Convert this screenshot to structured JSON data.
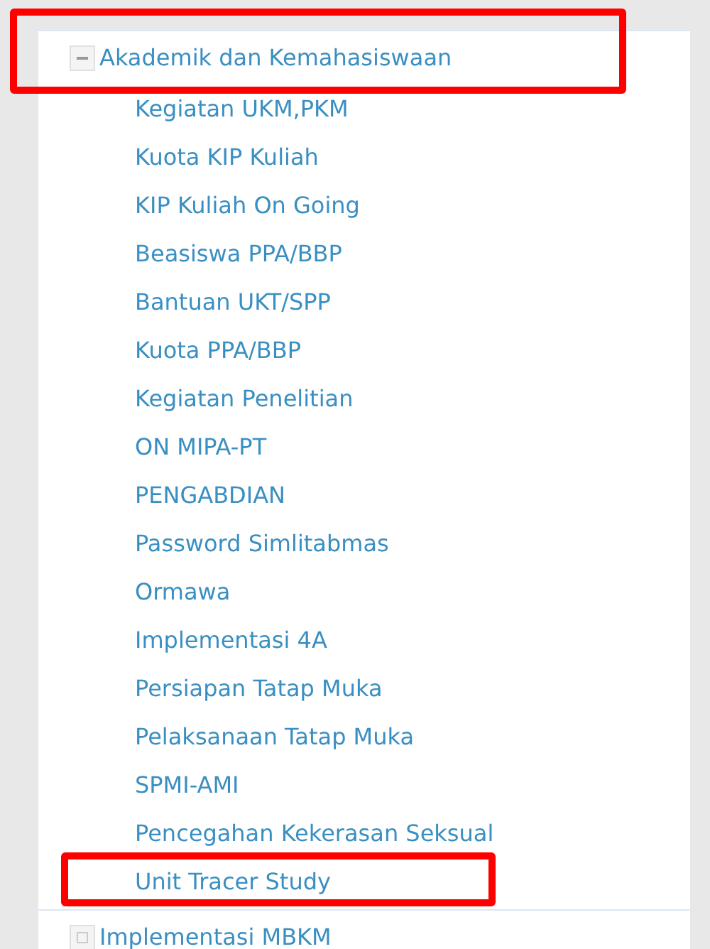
{
  "sections": [
    {
      "title": "Akademik dan Kemahasiswaan",
      "expanded": true,
      "highlighted": true,
      "children": [
        {
          "label": "Kegiatan UKM,PKM",
          "highlighted": false
        },
        {
          "label": "Kuota KIP Kuliah",
          "highlighted": false
        },
        {
          "label": "KIP Kuliah On Going",
          "highlighted": false
        },
        {
          "label": "Beasiswa PPA/BBP",
          "highlighted": false
        },
        {
          "label": "Bantuan UKT/SPP",
          "highlighted": false
        },
        {
          "label": "Kuota PPA/BBP",
          "highlighted": false
        },
        {
          "label": "Kegiatan Penelitian",
          "highlighted": false
        },
        {
          "label": "ON MIPA-PT",
          "highlighted": false
        },
        {
          "label": "PENGABDIAN",
          "highlighted": false
        },
        {
          "label": "Password Simlitabmas",
          "highlighted": false
        },
        {
          "label": "Ormawa",
          "highlighted": false
        },
        {
          "label": "Implementasi 4A",
          "highlighted": false
        },
        {
          "label": "Persiapan Tatap Muka",
          "highlighted": false
        },
        {
          "label": "Pelaksanaan Tatap Muka",
          "highlighted": false
        },
        {
          "label": "SPMI-AMI",
          "highlighted": false
        },
        {
          "label": "Pencegahan Kekerasan Seksual",
          "highlighted": false
        },
        {
          "label": "Unit Tracer Study",
          "highlighted": true
        }
      ]
    },
    {
      "title": "Implementasi MBKM",
      "expanded": false,
      "highlighted": false
    }
  ]
}
